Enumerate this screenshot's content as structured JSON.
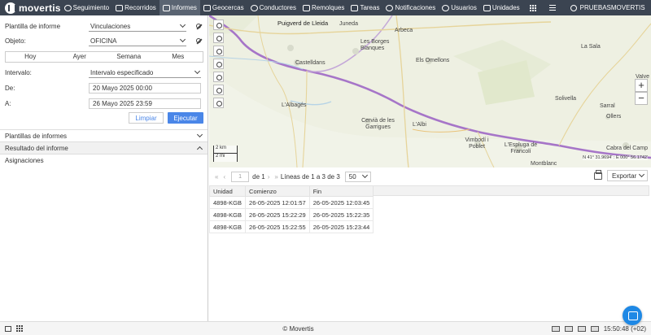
{
  "brand": {
    "name": "movertis"
  },
  "nav": {
    "items": [
      {
        "label": "Seguimiento",
        "icon": "globe-icon"
      },
      {
        "label": "Recorridos",
        "icon": "route-icon"
      },
      {
        "label": "Informes",
        "icon": "report-icon",
        "active": true
      },
      {
        "label": "Geocercas",
        "icon": "geofence-icon"
      },
      {
        "label": "Conductores",
        "icon": "steering-wheel-icon"
      },
      {
        "label": "Remolques",
        "icon": "trailer-icon"
      },
      {
        "label": "Tareas",
        "icon": "tasks-icon"
      },
      {
        "label": "Notificaciones",
        "icon": "bell-icon"
      },
      {
        "label": "Usuarios",
        "icon": "users-icon"
      },
      {
        "label": "Unidades",
        "icon": "truck-icon"
      }
    ],
    "user": "PRUEBASMOVERTIS"
  },
  "form": {
    "template_label": "Plantilla de informe",
    "template_value": "Vinculaciones",
    "object_label": "Objeto:",
    "object_value": "OFICINA",
    "periods": [
      "Hoy",
      "Ayer",
      "Semana",
      "Mes"
    ],
    "interval_label": "Intervalo:",
    "interval_value": "Intervalo especificado",
    "from_label": "De:",
    "from_value": "20 Mayo 2025 00:00",
    "to_label": "A:",
    "to_value": "26 Mayo 2025 23:59",
    "clear_label": "Limpiar",
    "run_label": "Ejecutar"
  },
  "sections": {
    "templates": "Plantillas de informes",
    "result": "Resultado del informe",
    "assignments": "Asignaciones"
  },
  "map": {
    "places": [
      {
        "name": "Puigverd de Lleida"
      },
      {
        "name": "Juneda"
      },
      {
        "name": "Arbeca"
      },
      {
        "name": "Les Borges Blanques"
      },
      {
        "name": "Els Omellons"
      },
      {
        "name": "Castelldans"
      },
      {
        "name": "La Sala"
      },
      {
        "name": "Valve de..."
      },
      {
        "name": "L'Albagés"
      },
      {
        "name": "Cervià de les Garrigues"
      },
      {
        "name": "L'Albi"
      },
      {
        "name": "Solivella"
      },
      {
        "name": "Sarral"
      },
      {
        "name": "Vimbodí i Poblet"
      },
      {
        "name": "L'Espluga de Francolí"
      },
      {
        "name": "Cabra del Camp"
      },
      {
        "name": "Montblanc"
      },
      {
        "name": "Ollers"
      }
    ],
    "scale_km": "2 km",
    "scale_mi": "2 mi",
    "coordinates": "N 41° 31.9694' : E 000° 56.1742'",
    "zoom_in": "+",
    "zoom_out": "−"
  },
  "results": {
    "page_current": "1",
    "page_of": "de 1",
    "lines_text": "Líneas de 1 a 3 de 3",
    "page_size": "50",
    "export_label": "Exportar",
    "columns": [
      "Unidad",
      "Comienzo",
      "Fin"
    ],
    "rows": [
      [
        "4898-KGB",
        "26-05-2025 12:01:57",
        "26-05-2025 12:03:45"
      ],
      [
        "4898-KGB",
        "26-05-2025 15:22:29",
        "26-05-2025 15:22:35"
      ],
      [
        "4898-KGB",
        "26-05-2025 15:22:55",
        "26-05-2025 15:23:44"
      ]
    ]
  },
  "footer": {
    "copyright": "© Movertis",
    "time": "15:50:48 (+02)"
  }
}
